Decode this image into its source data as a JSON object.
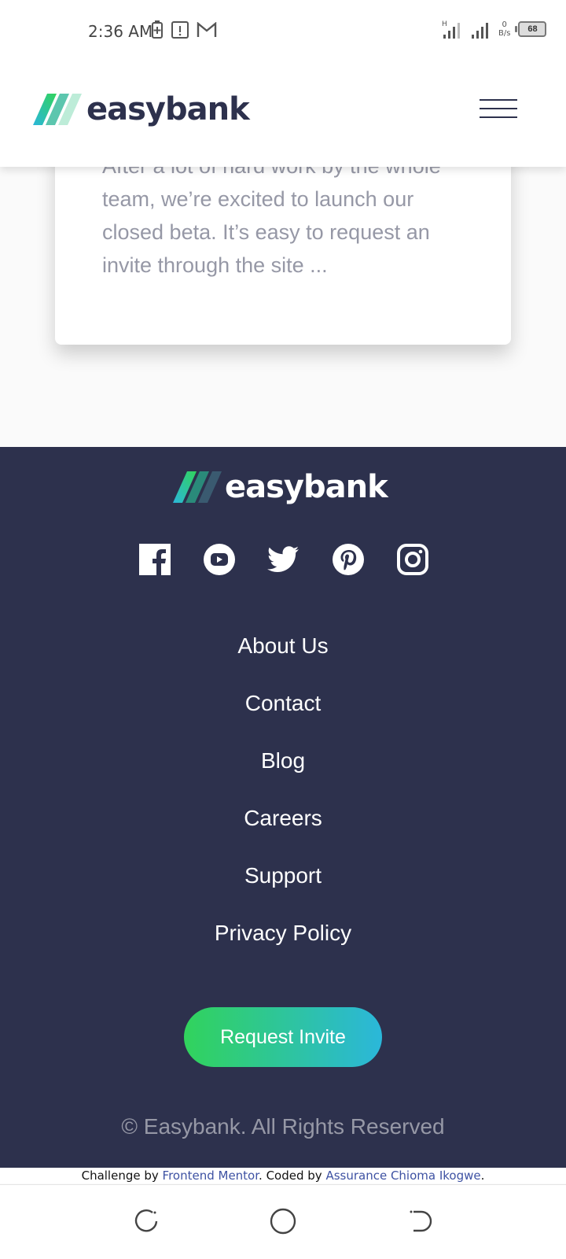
{
  "status_bar": {
    "time": "2:36 AM",
    "net_speed_value": "0",
    "net_speed_unit": "B/s",
    "battery_level": "68",
    "icons": [
      "battery-saver-icon",
      "sim-alert-icon",
      "gmail-icon",
      "signal-h-icon",
      "signal-icon",
      "battery-icon"
    ]
  },
  "header": {
    "logo_text": "easybank",
    "menu_icon": "hamburger-menu-icon"
  },
  "article": {
    "excerpt": "After a lot of hard work by the whole team, we’re excited to launch our closed beta. It’s easy to request an invite through the site ..."
  },
  "footer": {
    "logo_text": "easybank",
    "socials": [
      "facebook-icon",
      "youtube-icon",
      "twitter-icon",
      "pinterest-icon",
      "instagram-icon"
    ],
    "links": [
      "About Us",
      "Contact",
      "Blog",
      "Careers",
      "Support",
      "Privacy Policy"
    ],
    "cta_label": "Request Invite",
    "copyright": "© Easybank. All Rights Reserved",
    "colors": {
      "background": "#2d314d",
      "gradient_start": "#31d35c",
      "gradient_end": "#2bb7da"
    }
  },
  "attribution": {
    "prefix": "Challenge by ",
    "challenge_link": "Frontend Mentor",
    "middle": ". Coded by ",
    "author_link": "Assurance Chioma Ikogwe",
    "suffix": "."
  },
  "nav_bar": {
    "buttons": [
      "recent-apps-icon",
      "home-icon",
      "back-icon"
    ]
  }
}
